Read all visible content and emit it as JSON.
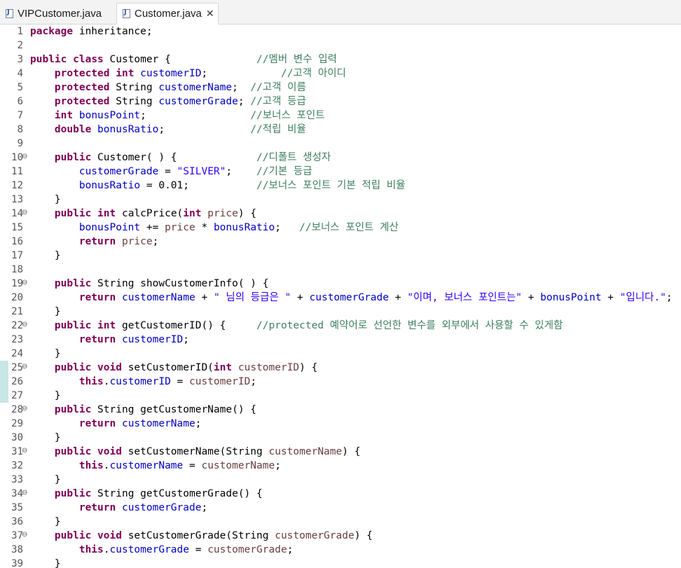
{
  "tabs": [
    {
      "label": "VIPCustomer.java",
      "active": false
    },
    {
      "label": "Customer.java",
      "active": true
    }
  ],
  "icons": {
    "java_file": "java-file-icon",
    "close": "close-icon",
    "fold": "fold-minus-icon"
  },
  "lines": [
    {
      "n": "1",
      "fold": false,
      "tokens": [
        [
          "k",
          "package"
        ],
        [
          "t",
          " inheritance;"
        ]
      ]
    },
    {
      "n": "2",
      "fold": false,
      "tokens": []
    },
    {
      "n": "3",
      "fold": false,
      "tokens": [
        [
          "k",
          "public"
        ],
        [
          "t",
          " "
        ],
        [
          "k",
          "class"
        ],
        [
          "t",
          " Customer {              "
        ],
        [
          "c",
          "//멤버 변수 입력"
        ]
      ]
    },
    {
      "n": "4",
      "fold": false,
      "tokens": [
        [
          "t",
          "    "
        ],
        [
          "k",
          "protected"
        ],
        [
          "t",
          " "
        ],
        [
          "k",
          "int"
        ],
        [
          "t",
          " "
        ],
        [
          "f",
          "customerID"
        ],
        [
          "t",
          ";            "
        ],
        [
          "c",
          "//고객 아이디"
        ]
      ]
    },
    {
      "n": "5",
      "fold": false,
      "tokens": [
        [
          "t",
          "    "
        ],
        [
          "k",
          "protected"
        ],
        [
          "t",
          " String "
        ],
        [
          "f",
          "customerName"
        ],
        [
          "t",
          ";  "
        ],
        [
          "c",
          "//고객 이름"
        ]
      ]
    },
    {
      "n": "6",
      "fold": false,
      "tokens": [
        [
          "t",
          "    "
        ],
        [
          "k",
          "protected"
        ],
        [
          "t",
          " String "
        ],
        [
          "f",
          "customerGrade"
        ],
        [
          "t",
          "; "
        ],
        [
          "c",
          "//고객 등급"
        ]
      ]
    },
    {
      "n": "7",
      "fold": false,
      "tokens": [
        [
          "t",
          "    "
        ],
        [
          "k",
          "int"
        ],
        [
          "t",
          " "
        ],
        [
          "f",
          "bonusPoint"
        ],
        [
          "t",
          ";                 "
        ],
        [
          "c",
          "//보너스 포인트"
        ]
      ]
    },
    {
      "n": "8",
      "fold": false,
      "tokens": [
        [
          "t",
          "    "
        ],
        [
          "k",
          "double"
        ],
        [
          "t",
          " "
        ],
        [
          "f",
          "bonusRatio"
        ],
        [
          "t",
          ";              "
        ],
        [
          "c",
          "//적립 비율"
        ]
      ]
    },
    {
      "n": "9",
      "fold": false,
      "tokens": []
    },
    {
      "n": "10",
      "fold": true,
      "tokens": [
        [
          "t",
          "    "
        ],
        [
          "k",
          "public"
        ],
        [
          "t",
          " Customer( ) {             "
        ],
        [
          "c",
          "//디폴트 생성자"
        ]
      ]
    },
    {
      "n": "11",
      "fold": false,
      "tokens": [
        [
          "t",
          "        "
        ],
        [
          "f",
          "customerGrade"
        ],
        [
          "t",
          " = "
        ],
        [
          "s",
          "\"SILVER\""
        ],
        [
          "t",
          ";    "
        ],
        [
          "c",
          "//기본 등급"
        ]
      ]
    },
    {
      "n": "12",
      "fold": false,
      "tokens": [
        [
          "t",
          "        "
        ],
        [
          "f",
          "bonusRatio"
        ],
        [
          "t",
          " = 0.01;           "
        ],
        [
          "c",
          "//보너스 포인트 기본 적립 비율"
        ]
      ]
    },
    {
      "n": "13",
      "fold": false,
      "tokens": [
        [
          "t",
          "    }"
        ]
      ]
    },
    {
      "n": "14",
      "fold": true,
      "tokens": [
        [
          "t",
          "    "
        ],
        [
          "k",
          "public"
        ],
        [
          "t",
          " "
        ],
        [
          "k",
          "int"
        ],
        [
          "t",
          " calcPrice("
        ],
        [
          "k",
          "int"
        ],
        [
          "t",
          " "
        ],
        [
          "p",
          "price"
        ],
        [
          "t",
          ") {"
        ]
      ]
    },
    {
      "n": "15",
      "fold": false,
      "tokens": [
        [
          "t",
          "        "
        ],
        [
          "f",
          "bonusPoint"
        ],
        [
          "t",
          " += "
        ],
        [
          "p",
          "price"
        ],
        [
          "t",
          " * "
        ],
        [
          "f",
          "bonusRatio"
        ],
        [
          "t",
          ";   "
        ],
        [
          "c",
          "//보너스 포인트 계산"
        ]
      ]
    },
    {
      "n": "16",
      "fold": false,
      "tokens": [
        [
          "t",
          "        "
        ],
        [
          "k",
          "return"
        ],
        [
          "t",
          " "
        ],
        [
          "p",
          "price"
        ],
        [
          "t",
          ";"
        ]
      ]
    },
    {
      "n": "17",
      "fold": false,
      "tokens": [
        [
          "t",
          "    }"
        ]
      ]
    },
    {
      "n": "18",
      "fold": false,
      "tokens": []
    },
    {
      "n": "19",
      "fold": true,
      "tokens": [
        [
          "t",
          "    "
        ],
        [
          "k",
          "public"
        ],
        [
          "t",
          " String showCustomerInfo( ) {"
        ]
      ]
    },
    {
      "n": "20",
      "fold": false,
      "tokens": [
        [
          "t",
          "        "
        ],
        [
          "k",
          "return"
        ],
        [
          "t",
          " "
        ],
        [
          "f",
          "customerName"
        ],
        [
          "t",
          " + "
        ],
        [
          "s",
          "\" 님의 등급은 \""
        ],
        [
          "t",
          " + "
        ],
        [
          "f",
          "customerGrade"
        ],
        [
          "t",
          " + "
        ],
        [
          "s",
          "\"이며, 보너스 포인트는\""
        ],
        [
          "t",
          " + "
        ],
        [
          "f",
          "bonusPoint"
        ],
        [
          "t",
          " + "
        ],
        [
          "s",
          "\"입니다.\""
        ],
        [
          "t",
          ";"
        ]
      ]
    },
    {
      "n": "21",
      "fold": false,
      "tokens": [
        [
          "t",
          "    }"
        ]
      ]
    },
    {
      "n": "22",
      "fold": true,
      "tokens": [
        [
          "t",
          "    "
        ],
        [
          "k",
          "public"
        ],
        [
          "t",
          " "
        ],
        [
          "k",
          "int"
        ],
        [
          "t",
          " getCustomerID() {     "
        ],
        [
          "c",
          "//protected 예약어로 선언한 변수를 외부에서 사용할 수 있게함"
        ]
      ]
    },
    {
      "n": "23",
      "fold": false,
      "tokens": [
        [
          "t",
          "        "
        ],
        [
          "k",
          "return"
        ],
        [
          "t",
          " "
        ],
        [
          "f",
          "customerID"
        ],
        [
          "t",
          ";"
        ]
      ]
    },
    {
      "n": "24",
      "fold": false,
      "tokens": [
        [
          "t",
          "    }"
        ]
      ]
    },
    {
      "n": "25",
      "fold": true,
      "tokens": [
        [
          "t",
          "    "
        ],
        [
          "k",
          "public"
        ],
        [
          "t",
          " "
        ],
        [
          "k",
          "void"
        ],
        [
          "t",
          " setCustomerID("
        ],
        [
          "k",
          "int"
        ],
        [
          "t",
          " "
        ],
        [
          "p",
          "customerID"
        ],
        [
          "t",
          ") {"
        ]
      ]
    },
    {
      "n": "26",
      "fold": false,
      "tokens": [
        [
          "t",
          "        "
        ],
        [
          "k",
          "this"
        ],
        [
          "t",
          "."
        ],
        [
          "f",
          "customerID"
        ],
        [
          "t",
          " = "
        ],
        [
          "p",
          "customerID"
        ],
        [
          "t",
          ";"
        ]
      ]
    },
    {
      "n": "27",
      "fold": false,
      "tokens": [
        [
          "t",
          "    }"
        ]
      ]
    },
    {
      "n": "28",
      "fold": true,
      "tokens": [
        [
          "t",
          "    "
        ],
        [
          "k",
          "public"
        ],
        [
          "t",
          " String getCustomerName() {"
        ]
      ]
    },
    {
      "n": "29",
      "fold": false,
      "tokens": [
        [
          "t",
          "        "
        ],
        [
          "k",
          "return"
        ],
        [
          "t",
          " "
        ],
        [
          "f",
          "customerName"
        ],
        [
          "t",
          ";"
        ]
      ]
    },
    {
      "n": "30",
      "fold": false,
      "tokens": [
        [
          "t",
          "    }"
        ]
      ]
    },
    {
      "n": "31",
      "fold": true,
      "tokens": [
        [
          "t",
          "    "
        ],
        [
          "k",
          "public"
        ],
        [
          "t",
          " "
        ],
        [
          "k",
          "void"
        ],
        [
          "t",
          " setCustomerName(String "
        ],
        [
          "p",
          "customerName"
        ],
        [
          "t",
          ") {"
        ]
      ]
    },
    {
      "n": "32",
      "fold": false,
      "tokens": [
        [
          "t",
          "        "
        ],
        [
          "k",
          "this"
        ],
        [
          "t",
          "."
        ],
        [
          "f",
          "customerName"
        ],
        [
          "t",
          " = "
        ],
        [
          "p",
          "customerName"
        ],
        [
          "t",
          ";"
        ]
      ]
    },
    {
      "n": "33",
      "fold": false,
      "tokens": [
        [
          "t",
          "    }"
        ]
      ]
    },
    {
      "n": "34",
      "fold": true,
      "tokens": [
        [
          "t",
          "    "
        ],
        [
          "k",
          "public"
        ],
        [
          "t",
          " String getCustomerGrade() {"
        ]
      ]
    },
    {
      "n": "35",
      "fold": false,
      "tokens": [
        [
          "t",
          "        "
        ],
        [
          "k",
          "return"
        ],
        [
          "t",
          " "
        ],
        [
          "f",
          "customerGrade"
        ],
        [
          "t",
          ";"
        ]
      ]
    },
    {
      "n": "36",
      "fold": false,
      "tokens": [
        [
          "t",
          "    }"
        ]
      ]
    },
    {
      "n": "37",
      "fold": true,
      "tokens": [
        [
          "t",
          "    "
        ],
        [
          "k",
          "public"
        ],
        [
          "t",
          " "
        ],
        [
          "k",
          "void"
        ],
        [
          "t",
          " setCustomerGrade(String "
        ],
        [
          "p",
          "customerGrade"
        ],
        [
          "t",
          ") {"
        ]
      ]
    },
    {
      "n": "38",
      "fold": false,
      "tokens": [
        [
          "t",
          "        "
        ],
        [
          "k",
          "this"
        ],
        [
          "t",
          "."
        ],
        [
          "f",
          "customerGrade"
        ],
        [
          "t",
          " = "
        ],
        [
          "p",
          "customerGrade"
        ],
        [
          "t",
          ";"
        ]
      ]
    },
    {
      "n": "39",
      "fold": false,
      "tokens": [
        [
          "t",
          "    }"
        ]
      ]
    }
  ]
}
